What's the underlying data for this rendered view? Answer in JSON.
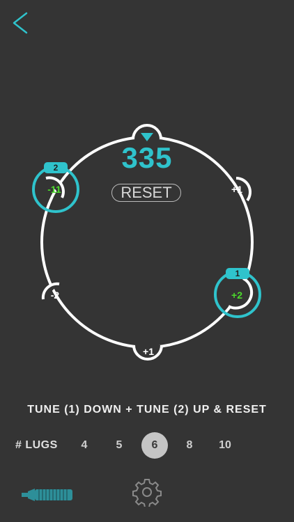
{
  "nav": {
    "back_icon": "chevron-left-icon"
  },
  "colors": {
    "accent": "#2fc3cc",
    "highlight": "#4cdb2c",
    "background": "#343434"
  },
  "drum": {
    "tension": "335",
    "reset_label": "RESET",
    "lugs": [
      {
        "value": "-11",
        "badge": "2",
        "selected": true
      },
      {
        "value": "+1",
        "badge": "",
        "selected": false
      },
      {
        "value": "+2",
        "badge": "1",
        "selected": true
      },
      {
        "value": "+1",
        "badge": "",
        "selected": false
      },
      {
        "value": "-2",
        "badge": "",
        "selected": false
      }
    ]
  },
  "instruction": "TUNE (1) DOWN + TUNE (2) UP & RESET",
  "lug_selector": {
    "label": "# LUGS",
    "options": [
      "4",
      "5",
      "6",
      "8",
      "10"
    ],
    "selected": "6"
  },
  "toolbar": {
    "tool_icon": "drum-key-icon",
    "settings_icon": "gear-icon"
  }
}
